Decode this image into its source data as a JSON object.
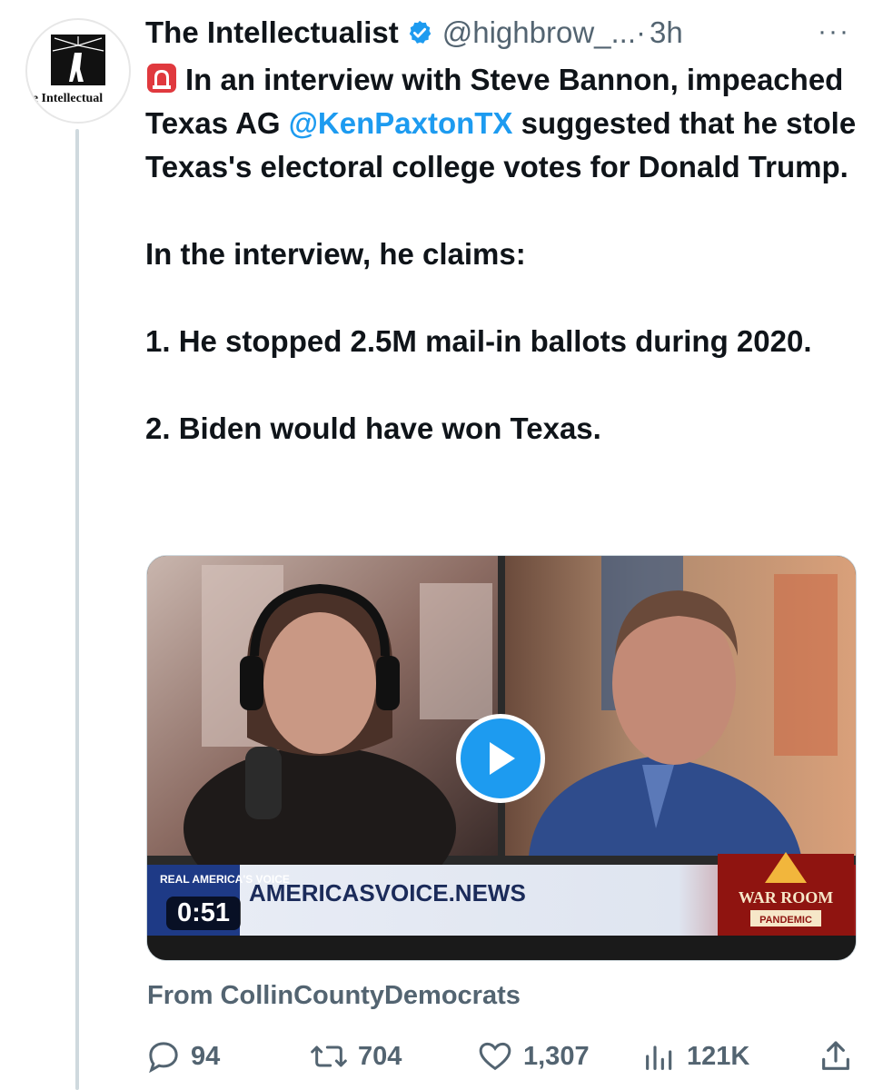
{
  "author": {
    "display_name": "The Intellectualist",
    "handle": "@highbrow_...",
    "separator": "·",
    "time": "3h",
    "verified": true,
    "avatar_text": "he Intellectual"
  },
  "more_label": "···",
  "tweet": {
    "line1_text": "In an interview with Steve Bannon, impeached Texas AG ",
    "mention": "@KenPaxtonTX",
    "line1_rest": " suggested that he stole Texas's electoral college votes for Donald Trump.",
    "para2": "In the interview, he claims:",
    "para3": "1. He stopped 2.5M mail-in ballots during 2020.",
    "para4": "2. Biden would have won Texas."
  },
  "media": {
    "duration": "0:51",
    "lower_third_brand": "REAL AMERICA'S VOICE",
    "lower_third_text": "AMERICASVOICE.NEWS",
    "show_logo": "WAR ROOM",
    "show_sub": "PANDEMIC"
  },
  "source_label": "From CollinCountyDemocrats",
  "actions": {
    "replies": "94",
    "retweets": "704",
    "likes": "1,307",
    "views": "121K"
  },
  "colors": {
    "accent": "#1d9bf0",
    "text": "#0f1419",
    "muted": "#536471"
  }
}
